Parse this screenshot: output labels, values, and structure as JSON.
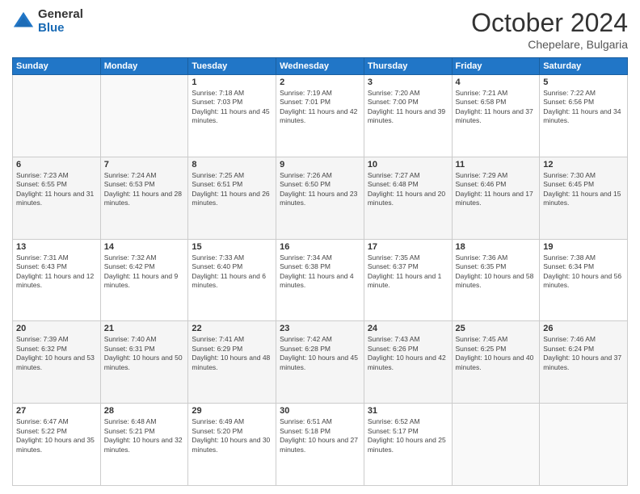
{
  "header": {
    "logo_general": "General",
    "logo_blue": "Blue",
    "month_title": "October 2024",
    "location": "Chepelare, Bulgaria"
  },
  "days_of_week": [
    "Sunday",
    "Monday",
    "Tuesday",
    "Wednesday",
    "Thursday",
    "Friday",
    "Saturday"
  ],
  "weeks": [
    [
      {
        "num": "",
        "info": ""
      },
      {
        "num": "",
        "info": ""
      },
      {
        "num": "1",
        "info": "Sunrise: 7:18 AM\nSunset: 7:03 PM\nDaylight: 11 hours and 45 minutes."
      },
      {
        "num": "2",
        "info": "Sunrise: 7:19 AM\nSunset: 7:01 PM\nDaylight: 11 hours and 42 minutes."
      },
      {
        "num": "3",
        "info": "Sunrise: 7:20 AM\nSunset: 7:00 PM\nDaylight: 11 hours and 39 minutes."
      },
      {
        "num": "4",
        "info": "Sunrise: 7:21 AM\nSunset: 6:58 PM\nDaylight: 11 hours and 37 minutes."
      },
      {
        "num": "5",
        "info": "Sunrise: 7:22 AM\nSunset: 6:56 PM\nDaylight: 11 hours and 34 minutes."
      }
    ],
    [
      {
        "num": "6",
        "info": "Sunrise: 7:23 AM\nSunset: 6:55 PM\nDaylight: 11 hours and 31 minutes."
      },
      {
        "num": "7",
        "info": "Sunrise: 7:24 AM\nSunset: 6:53 PM\nDaylight: 11 hours and 28 minutes."
      },
      {
        "num": "8",
        "info": "Sunrise: 7:25 AM\nSunset: 6:51 PM\nDaylight: 11 hours and 26 minutes."
      },
      {
        "num": "9",
        "info": "Sunrise: 7:26 AM\nSunset: 6:50 PM\nDaylight: 11 hours and 23 minutes."
      },
      {
        "num": "10",
        "info": "Sunrise: 7:27 AM\nSunset: 6:48 PM\nDaylight: 11 hours and 20 minutes."
      },
      {
        "num": "11",
        "info": "Sunrise: 7:29 AM\nSunset: 6:46 PM\nDaylight: 11 hours and 17 minutes."
      },
      {
        "num": "12",
        "info": "Sunrise: 7:30 AM\nSunset: 6:45 PM\nDaylight: 11 hours and 15 minutes."
      }
    ],
    [
      {
        "num": "13",
        "info": "Sunrise: 7:31 AM\nSunset: 6:43 PM\nDaylight: 11 hours and 12 minutes."
      },
      {
        "num": "14",
        "info": "Sunrise: 7:32 AM\nSunset: 6:42 PM\nDaylight: 11 hours and 9 minutes."
      },
      {
        "num": "15",
        "info": "Sunrise: 7:33 AM\nSunset: 6:40 PM\nDaylight: 11 hours and 6 minutes."
      },
      {
        "num": "16",
        "info": "Sunrise: 7:34 AM\nSunset: 6:38 PM\nDaylight: 11 hours and 4 minutes."
      },
      {
        "num": "17",
        "info": "Sunrise: 7:35 AM\nSunset: 6:37 PM\nDaylight: 11 hours and 1 minute."
      },
      {
        "num": "18",
        "info": "Sunrise: 7:36 AM\nSunset: 6:35 PM\nDaylight: 10 hours and 58 minutes."
      },
      {
        "num": "19",
        "info": "Sunrise: 7:38 AM\nSunset: 6:34 PM\nDaylight: 10 hours and 56 minutes."
      }
    ],
    [
      {
        "num": "20",
        "info": "Sunrise: 7:39 AM\nSunset: 6:32 PM\nDaylight: 10 hours and 53 minutes."
      },
      {
        "num": "21",
        "info": "Sunrise: 7:40 AM\nSunset: 6:31 PM\nDaylight: 10 hours and 50 minutes."
      },
      {
        "num": "22",
        "info": "Sunrise: 7:41 AM\nSunset: 6:29 PM\nDaylight: 10 hours and 48 minutes."
      },
      {
        "num": "23",
        "info": "Sunrise: 7:42 AM\nSunset: 6:28 PM\nDaylight: 10 hours and 45 minutes."
      },
      {
        "num": "24",
        "info": "Sunrise: 7:43 AM\nSunset: 6:26 PM\nDaylight: 10 hours and 42 minutes."
      },
      {
        "num": "25",
        "info": "Sunrise: 7:45 AM\nSunset: 6:25 PM\nDaylight: 10 hours and 40 minutes."
      },
      {
        "num": "26",
        "info": "Sunrise: 7:46 AM\nSunset: 6:24 PM\nDaylight: 10 hours and 37 minutes."
      }
    ],
    [
      {
        "num": "27",
        "info": "Sunrise: 6:47 AM\nSunset: 5:22 PM\nDaylight: 10 hours and 35 minutes."
      },
      {
        "num": "28",
        "info": "Sunrise: 6:48 AM\nSunset: 5:21 PM\nDaylight: 10 hours and 32 minutes."
      },
      {
        "num": "29",
        "info": "Sunrise: 6:49 AM\nSunset: 5:20 PM\nDaylight: 10 hours and 30 minutes."
      },
      {
        "num": "30",
        "info": "Sunrise: 6:51 AM\nSunset: 5:18 PM\nDaylight: 10 hours and 27 minutes."
      },
      {
        "num": "31",
        "info": "Sunrise: 6:52 AM\nSunset: 5:17 PM\nDaylight: 10 hours and 25 minutes."
      },
      {
        "num": "",
        "info": ""
      },
      {
        "num": "",
        "info": ""
      }
    ]
  ]
}
